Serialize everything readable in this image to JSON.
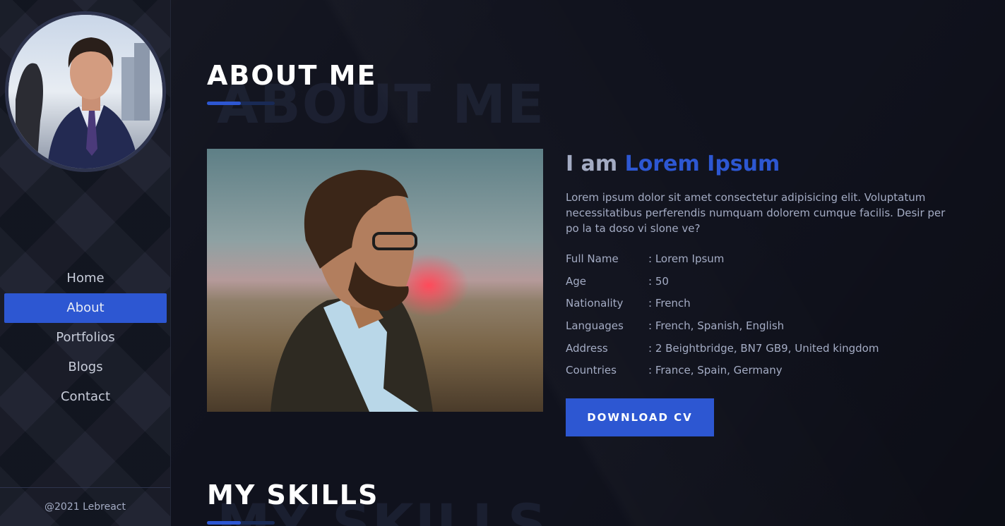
{
  "sidebar": {
    "nav": [
      {
        "label": "Home"
      },
      {
        "label": "About",
        "active": true
      },
      {
        "label": "Portfolios"
      },
      {
        "label": "Blogs"
      },
      {
        "label": "Contact"
      }
    ],
    "footer": "@2021 Lebreact"
  },
  "about": {
    "title": "ABOUT ME",
    "heading_prefix": "I am",
    "heading_name": "Lorem Ipsum",
    "description": "Lorem ipsum dolor sit amet consectetur adipisicing elit. Voluptatum necessitatibus perferendis numquam dolorem cumque facilis. Desir per po la ta doso vi slone ve?",
    "info": [
      {
        "label": "Full Name",
        "value": ": Lorem Ipsum"
      },
      {
        "label": "Age",
        "value": ": 50"
      },
      {
        "label": "Nationality",
        "value": ": French"
      },
      {
        "label": "Languages",
        "value": ": French, Spanish, English"
      },
      {
        "label": "Address",
        "value": ": 2 Beightbridge, BN7 GB9, United kingdom"
      },
      {
        "label": "Countries",
        "value": ": France, Spain, Germany"
      }
    ],
    "download_label": "DOWNLOAD CV"
  },
  "skills": {
    "title": "MY SKILLS"
  },
  "colors": {
    "accent": "#2d57d2",
    "sidebar_bg": "#191d2b",
    "main_bg": "#10121d",
    "text": "#a4acc4"
  }
}
